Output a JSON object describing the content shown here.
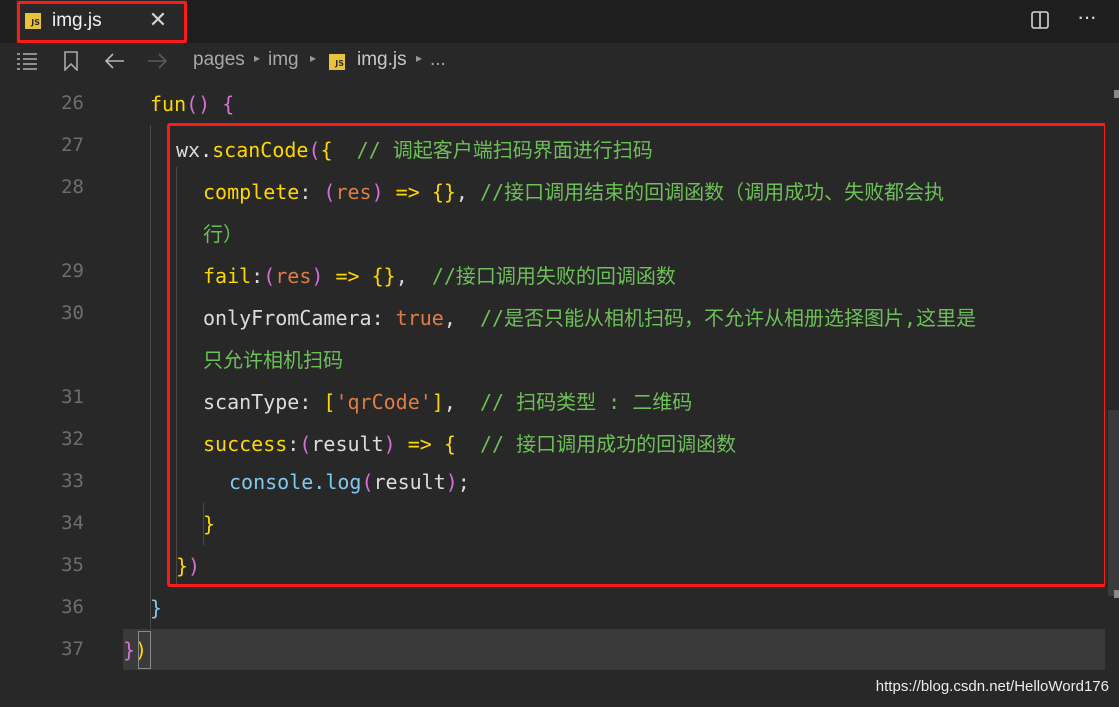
{
  "tab": {
    "icon": "JS",
    "title": "img.js",
    "close": "✕"
  },
  "toolbar": {
    "more": "···"
  },
  "breadcrumb": {
    "items": [
      "pages",
      "img",
      "img.js",
      "..."
    ],
    "separator": "▸",
    "file_icon": "JS"
  },
  "editor": {
    "lines": [
      {
        "number": "26",
        "indent": 150,
        "tokens": [
          {
            "t": "fun",
            "c": "#ffd700"
          },
          {
            "t": "() {",
            "c": "#d670d6"
          }
        ]
      },
      {
        "number": "27",
        "indent": 176,
        "tokens": [
          {
            "t": "wx.",
            "c": "#dcdcdc"
          },
          {
            "t": "scanCode",
            "c": "#ffd700"
          },
          {
            "t": "(",
            "c": "#d670d6"
          },
          {
            "t": "{",
            "c": "#ffd700"
          },
          {
            "t": "  // 调起客户端扫码界面进行扫码",
            "c": "#6dbf58"
          }
        ]
      },
      {
        "number": "28",
        "indent": 203,
        "tokens": [
          {
            "t": "complete",
            "c": "#ffd700"
          },
          {
            "t": ": ",
            "c": "#dcdcdc"
          },
          {
            "t": "(",
            "c": "#d670d6"
          },
          {
            "t": "res",
            "c": "#e07c45"
          },
          {
            "t": ")",
            "c": "#d670d6"
          },
          {
            "t": " => ",
            "c": "#ffd700"
          },
          {
            "t": "{}",
            "c": "#ffd700"
          },
          {
            "t": ", ",
            "c": "#dcdcdc"
          },
          {
            "t": "//接口调用结束的回调函数（调用成功、失败都会执",
            "c": "#6dbf58"
          }
        ]
      },
      {
        "number": "",
        "indent": 203,
        "tokens": [
          {
            "t": "行）",
            "c": "#6dbf58"
          }
        ]
      },
      {
        "number": "29",
        "indent": 203,
        "tokens": [
          {
            "t": "fail",
            "c": "#ffd700"
          },
          {
            "t": ":",
            "c": "#dcdcdc"
          },
          {
            "t": "(",
            "c": "#d670d6"
          },
          {
            "t": "res",
            "c": "#e07c45"
          },
          {
            "t": ")",
            "c": "#d670d6"
          },
          {
            "t": " => ",
            "c": "#ffd700"
          },
          {
            "t": "{}",
            "c": "#ffd700"
          },
          {
            "t": ",  ",
            "c": "#dcdcdc"
          },
          {
            "t": "//接口调用失败的回调函数",
            "c": "#6dbf58"
          }
        ]
      },
      {
        "number": "30",
        "indent": 203,
        "tokens": [
          {
            "t": "onlyFromCamera",
            "c": "#dcdcdc"
          },
          {
            "t": ": ",
            "c": "#dcdcdc"
          },
          {
            "t": "true",
            "c": "#e07c45"
          },
          {
            "t": ",  ",
            "c": "#dcdcdc"
          },
          {
            "t": "//是否只能从相机扫码，不允许从相册选择图片,这里是",
            "c": "#6dbf58"
          }
        ]
      },
      {
        "number": "",
        "indent": 203,
        "tokens": [
          {
            "t": "只允许相机扫码",
            "c": "#6dbf58"
          }
        ]
      },
      {
        "number": "31",
        "indent": 203,
        "tokens": [
          {
            "t": "scanType",
            "c": "#dcdcdc"
          },
          {
            "t": ": ",
            "c": "#dcdcdc"
          },
          {
            "t": "[",
            "c": "#ffd700"
          },
          {
            "t": "'qrCode'",
            "c": "#e07c45"
          },
          {
            "t": "]",
            "c": "#ffd700"
          },
          {
            "t": ",  ",
            "c": "#dcdcdc"
          },
          {
            "t": "// 扫码类型 : 二维码",
            "c": "#6dbf58"
          }
        ]
      },
      {
        "number": "32",
        "indent": 203,
        "tokens": [
          {
            "t": "success",
            "c": "#ffd700"
          },
          {
            "t": ":",
            "c": "#dcdcdc"
          },
          {
            "t": "(",
            "c": "#d670d6"
          },
          {
            "t": "result",
            "c": "#dcdcdc"
          },
          {
            "t": ")",
            "c": "#d670d6"
          },
          {
            "t": " => ",
            "c": "#ffd700"
          },
          {
            "t": "{",
            "c": "#ffd700"
          },
          {
            "t": "  // 接口调用成功的回调函数",
            "c": "#6dbf58"
          }
        ]
      },
      {
        "number": "33",
        "indent": 229,
        "tokens": [
          {
            "t": "console.",
            "c": "#7fc8f0"
          },
          {
            "t": "log",
            "c": "#7fc8f0"
          },
          {
            "t": "(",
            "c": "#d670d6"
          },
          {
            "t": "result",
            "c": "#dcdcdc"
          },
          {
            "t": ")",
            "c": "#d670d6"
          },
          {
            "t": ";",
            "c": "#dcdcdc"
          }
        ]
      },
      {
        "number": "34",
        "indent": 203,
        "tokens": [
          {
            "t": "}",
            "c": "#ffd700"
          }
        ]
      },
      {
        "number": "35",
        "indent": 176,
        "tokens": [
          {
            "t": "}",
            "c": "#ffd700"
          },
          {
            "t": ")",
            "c": "#d670d6"
          }
        ]
      },
      {
        "number": "36",
        "indent": 150,
        "tokens": [
          {
            "t": "}",
            "c": "#7fc8f0"
          }
        ]
      },
      {
        "number": "37",
        "indent": 123,
        "tokens": [
          {
            "t": "}",
            "c": "#d670d6"
          },
          {
            "t": ")",
            "c": "#ffd700"
          }
        ]
      }
    ]
  },
  "watermark": "https://blog.csdn.net/HelloWord176"
}
